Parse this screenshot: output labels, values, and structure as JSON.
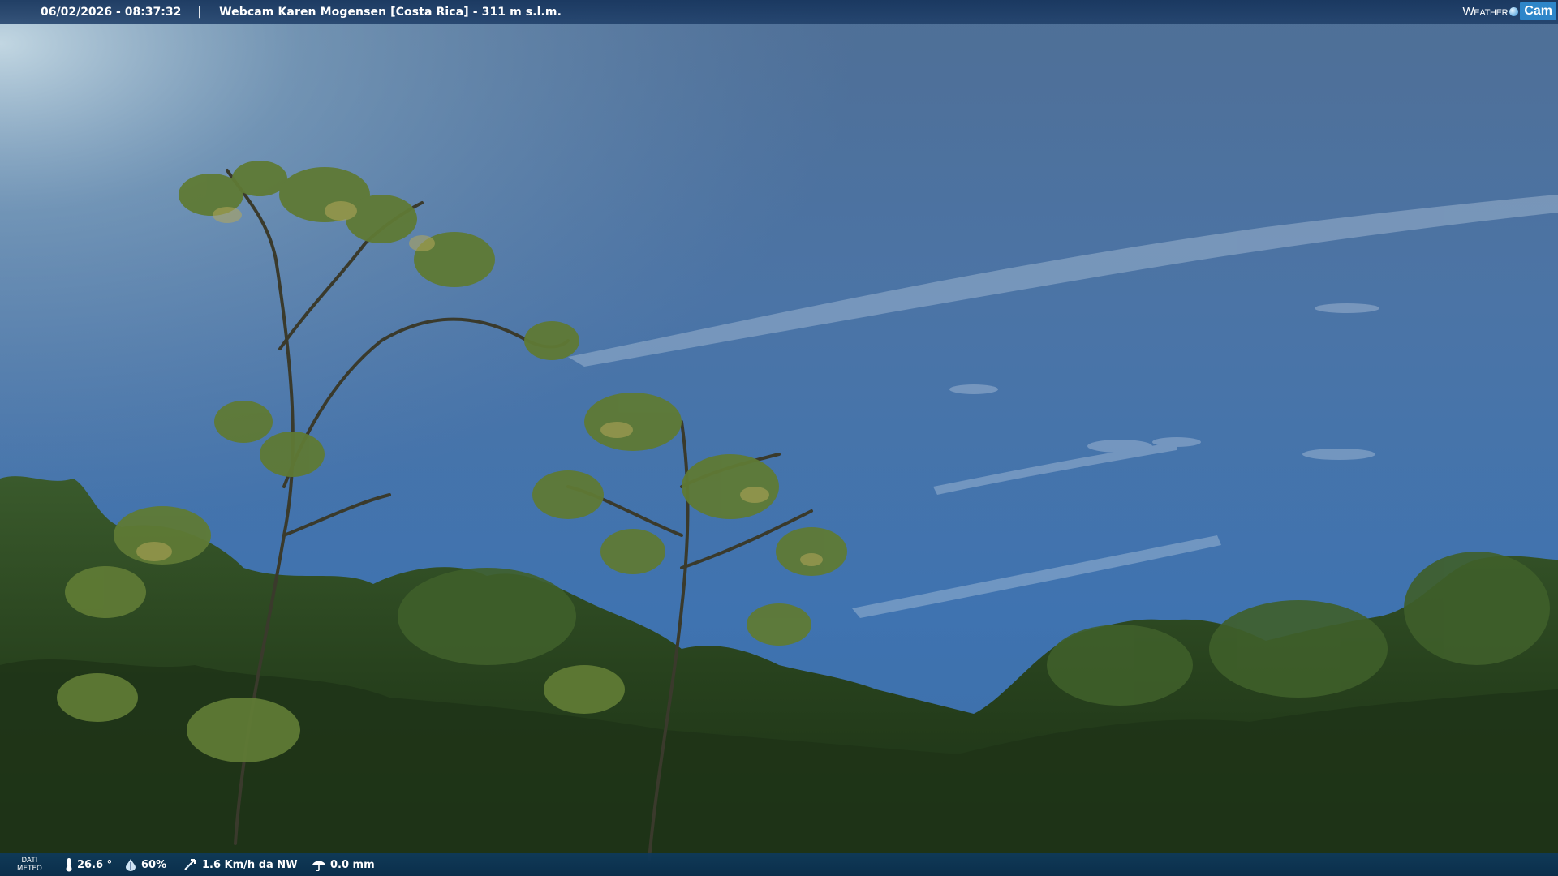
{
  "header": {
    "datetime": "06/02/2026 - 08:37:32",
    "separator": "|",
    "title": "Webcam Karen Mogensen [Costa Rica] - 311 m s.l.m."
  },
  "logo": {
    "text_weather": "Weather",
    "text_cam": "Cam"
  },
  "footer": {
    "dati_line1": "DATI",
    "dati_line2": "METEO",
    "temperature": "26.6 °",
    "humidity": "60%",
    "wind": "1.6 Km/h da NW",
    "rain": "0.0 mm",
    "icons": [
      "thermometer-icon",
      "humidity-icon",
      "wind-icon",
      "rain-gauge-icon"
    ]
  },
  "colors": {
    "sky_top": "#5a7aa0",
    "sky_bottom": "#3a6fae",
    "foliage": "#2c4a22",
    "bar": "#17396a"
  }
}
